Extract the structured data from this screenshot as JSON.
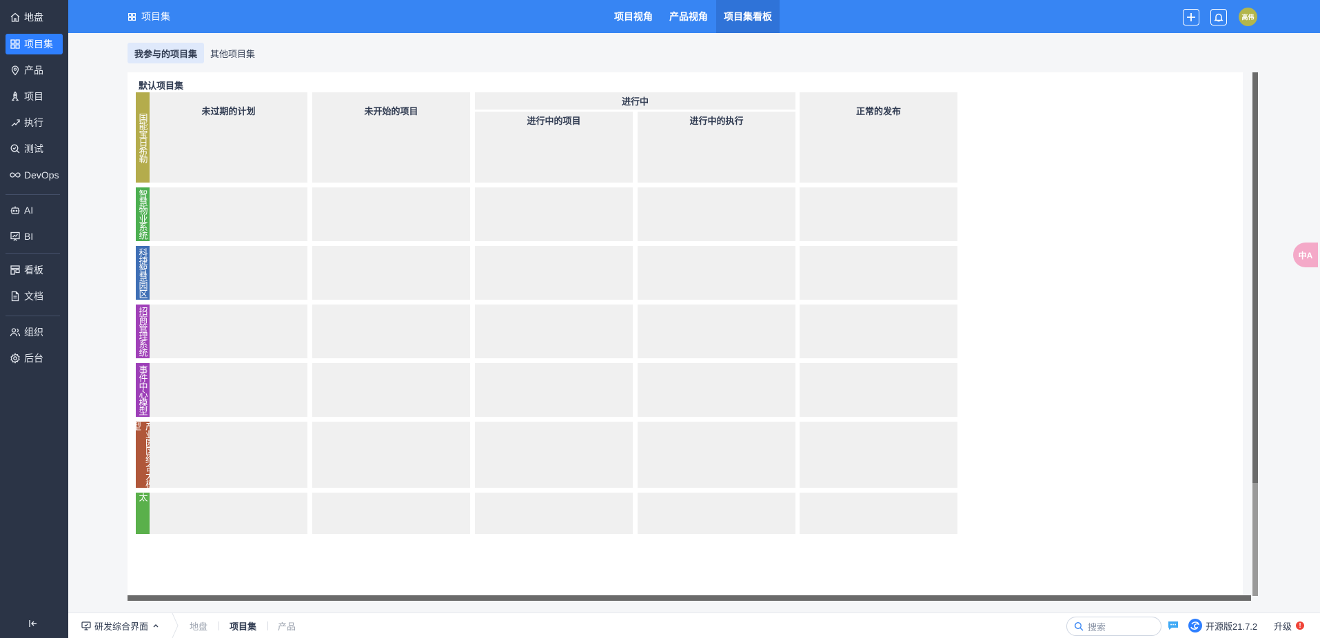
{
  "sidebar": {
    "items": [
      {
        "label": "地盘",
        "icon": "home-icon"
      },
      {
        "label": "项目集",
        "icon": "grid-icon",
        "active": true
      },
      {
        "label": "产品",
        "icon": "location-pin-icon"
      },
      {
        "label": "项目",
        "icon": "rocket-icon"
      },
      {
        "label": "执行",
        "icon": "run-icon"
      },
      {
        "label": "测试",
        "icon": "test-search-icon"
      },
      {
        "label": "DevOps",
        "icon": "infinity-icon"
      },
      {
        "label": "AI",
        "icon": "robot-icon"
      },
      {
        "label": "BI",
        "icon": "chart-board-icon"
      },
      {
        "label": "看板",
        "icon": "kanban-icon"
      },
      {
        "label": "文档",
        "icon": "document-icon"
      },
      {
        "label": "组织",
        "icon": "people-icon"
      },
      {
        "label": "后台",
        "icon": "settings-gear-icon"
      }
    ]
  },
  "header": {
    "title": "项目集",
    "tabs": [
      {
        "label": "项目视角"
      },
      {
        "label": "产品视角"
      },
      {
        "label": "项目集看板",
        "active": true
      }
    ],
    "avatar_text": "高伟",
    "accent": "#3785f3"
  },
  "subtabs": [
    {
      "label": "我参与的项目集",
      "active": true
    },
    {
      "label": "其他项目集"
    }
  ],
  "board": {
    "title": "默认项目集",
    "columns": {
      "unexpired_plans": "未过期的计划",
      "unstarted_projects": "未开始的项目",
      "in_progress": "进行中",
      "in_progress_projects": "进行中的项目",
      "in_progress_executions": "进行中的执行",
      "normal_releases": "正常的发布"
    },
    "lanes": [
      {
        "name": "国能宝日希勒",
        "color": "#b4ac4c"
      },
      {
        "name": "智慧物业系统",
        "color": "#4caf50"
      },
      {
        "name": "科捷智慧园区",
        "color": "#3f6fb5"
      },
      {
        "name": "招商管理系统",
        "color": "#a040b8"
      },
      {
        "name": "事件中心模型",
        "color": "#9d3fb8"
      },
      {
        "name": "产业园区结合大模型",
        "color": "#b0573a"
      },
      {
        "name": "太",
        "color": "#5ab04b"
      }
    ]
  },
  "float_tag": "中A",
  "footer": {
    "workspace": "研发综合界面",
    "breadcrumbs": [
      {
        "label": "地盘"
      },
      {
        "label": "项目集",
        "current": true
      },
      {
        "label": "产品"
      }
    ],
    "search_placeholder": "搜索",
    "version": "开源版21.7.2",
    "upgrade": "升级",
    "upgrade_badge": "!"
  }
}
